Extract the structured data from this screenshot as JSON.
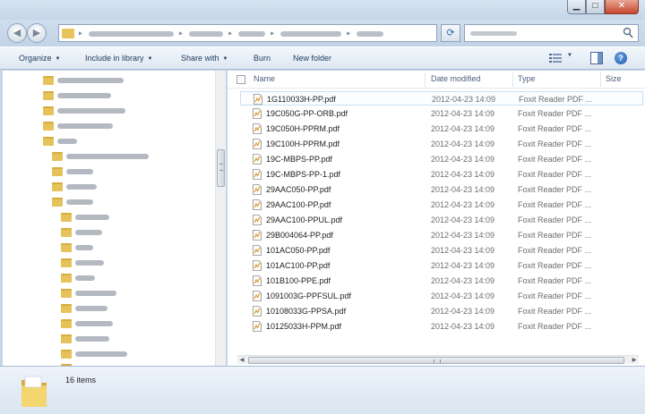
{
  "commandbar": {
    "organize": "Organize",
    "include_in_library": "Include in library",
    "share_with": "Share with",
    "burn": "Burn",
    "new_folder": "New folder"
  },
  "columns": {
    "name": "Name",
    "date_modified": "Date modified",
    "type": "Type",
    "size": "Size"
  },
  "files": [
    {
      "name": "1G110033H-PP.pdf",
      "date": "2012-04-23 14:09",
      "type": "Foxit Reader PDF ..."
    },
    {
      "name": "19C050G-PP-ORB.pdf",
      "date": "2012-04-23 14:09",
      "type": "Foxit Reader PDF ..."
    },
    {
      "name": "19C050H-PPRM.pdf",
      "date": "2012-04-23 14:09",
      "type": "Foxit Reader PDF ..."
    },
    {
      "name": "19C100H-PPRM.pdf",
      "date": "2012-04-23 14:09",
      "type": "Foxit Reader PDF ..."
    },
    {
      "name": "19C-MBPS-PP.pdf",
      "date": "2012-04-23 14:09",
      "type": "Foxit Reader PDF ..."
    },
    {
      "name": "19C-MBPS-PP-1.pdf",
      "date": "2012-04-23 14:09",
      "type": "Foxit Reader PDF ..."
    },
    {
      "name": "29AAC050-PP.pdf",
      "date": "2012-04-23 14:09",
      "type": "Foxit Reader PDF ..."
    },
    {
      "name": "29AAC100-PP.pdf",
      "date": "2012-04-23 14:09",
      "type": "Foxit Reader PDF ..."
    },
    {
      "name": "29AAC100-PPUL.pdf",
      "date": "2012-04-23 14:09",
      "type": "Foxit Reader PDF ..."
    },
    {
      "name": "29B004064-PP.pdf",
      "date": "2012-04-23 14:09",
      "type": "Foxit Reader PDF ..."
    },
    {
      "name": "101AC050-PP.pdf",
      "date": "2012-04-23 14:09",
      "type": "Foxit Reader PDF ..."
    },
    {
      "name": "101AC100-PP.pdf",
      "date": "2012-04-23 14:09",
      "type": "Foxit Reader PDF ..."
    },
    {
      "name": "101B100-PPE.pdf",
      "date": "2012-04-23 14:09",
      "type": "Foxit Reader PDF ..."
    },
    {
      "name": "1091003G-PPFSUL.pdf",
      "date": "2012-04-23 14:09",
      "type": "Foxit Reader PDF ..."
    },
    {
      "name": "10108033G-PPSA.pdf",
      "date": "2012-04-23 14:09",
      "type": "Foxit Reader PDF ..."
    },
    {
      "name": "10125033H-PPM.pdf",
      "date": "2012-04-23 14:09",
      "type": "Foxit Reader PDF ..."
    }
  ],
  "details": {
    "item_count": "16 items"
  },
  "icons": {
    "title_minimize": "minimize-icon",
    "title_maximize": "maximize-icon",
    "title_close": "close-icon",
    "back": "back-arrow-icon",
    "forward": "forward-arrow-icon",
    "refresh": "refresh-icon",
    "search": "search-icon",
    "views": "views-icon",
    "preview_pane": "preview-pane-icon",
    "help": "help-icon",
    "file": "pdf-file-icon",
    "folder": "folder-icon"
  },
  "colors": {
    "chrome": "#c4d5e8",
    "command_text": "#1e395b",
    "folder": "#e6c35a",
    "close_button": "#c7452d",
    "selection_border": "#c9dff4"
  }
}
